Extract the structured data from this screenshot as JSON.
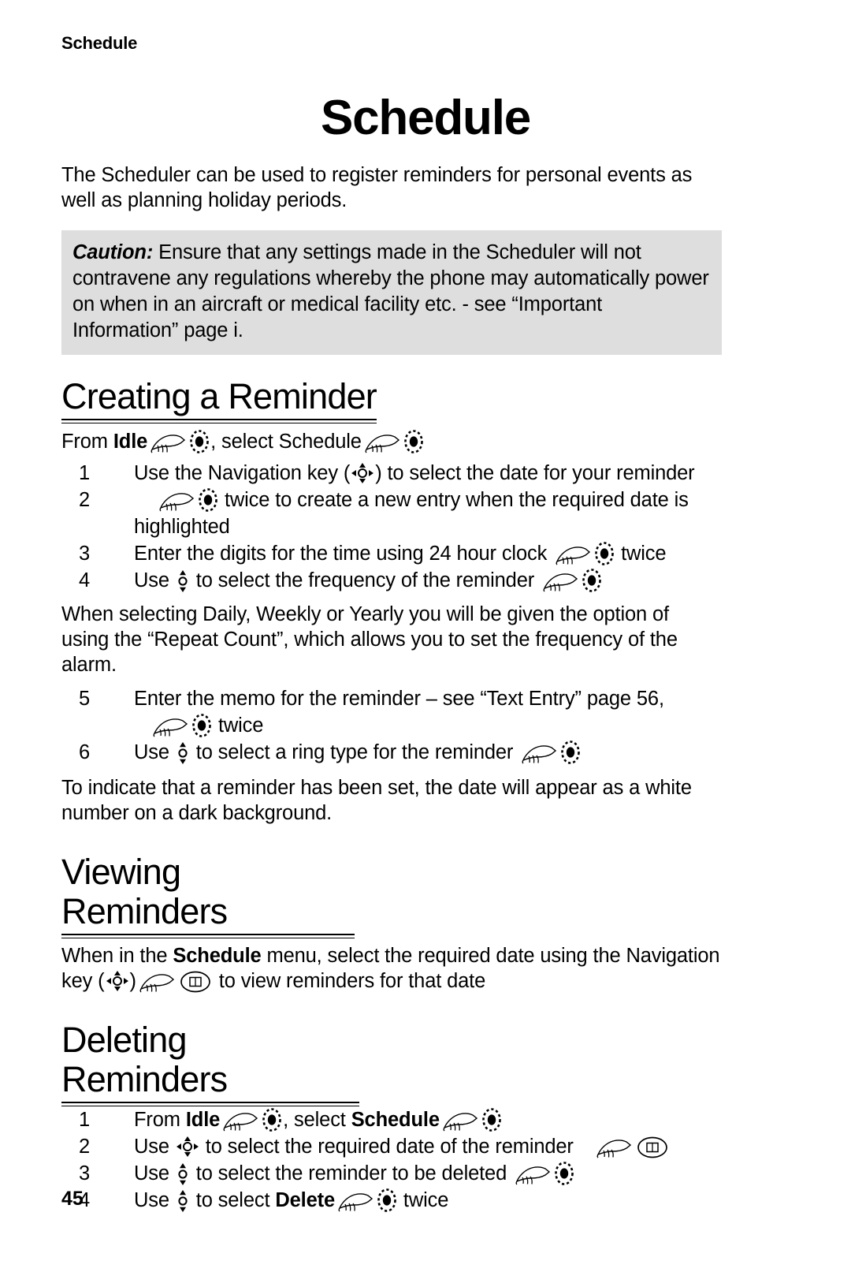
{
  "header": {
    "running_header": "Schedule",
    "title": "Schedule"
  },
  "intro": {
    "text": "The Scheduler can be used to register reminders for personal events as well as planning holiday periods."
  },
  "caution": {
    "label": "Caution:",
    "text": " Ensure that any settings made in the Scheduler will not contravene any regulations whereby the phone may automatically power on when in an aircraft or medical facility etc. - see “Important Information” page i.",
    "background_color": "#dedede"
  },
  "sections": {
    "creating": {
      "heading": "Creating a Reminder",
      "lead": {
        "from": "From ",
        "idle": "Idle",
        "comma_select": ", select Schedule"
      },
      "steps": [
        {
          "num": "1",
          "parts": [
            "Use the Navigation key (",
            ") to select the date for your reminder"
          ],
          "icons": [
            "nav-4way-icon"
          ]
        },
        {
          "num": "2",
          "parts": [
            "",
            "twice to create a new entry when the required date is highlighted"
          ],
          "icons": [
            "hand-pointer-icon",
            "select-key-icon"
          ]
        },
        {
          "num": "3",
          "parts": [
            "Enter the digits for the time using 24 hour clock ",
            "twice"
          ],
          "icons": [
            "hand-pointer-icon",
            "select-key-icon"
          ]
        },
        {
          "num": "4",
          "parts": [
            "Use ",
            " to select the frequency of the reminder "
          ],
          "icons": [
            "nav-updown-icon",
            "hand-pointer-icon",
            "select-key-icon"
          ]
        }
      ],
      "note": "When selecting Daily, Weekly or Yearly you will be given the option of using the “Repeat Count”, which allows you to set the frequency of the alarm.",
      "steps2": [
        {
          "num": "5",
          "parts": [
            "Enter the memo for the reminder – see “Text Entry” page 56,",
            "twice"
          ],
          "icons": [
            "hand-pointer-icon",
            "select-key-icon"
          ]
        },
        {
          "num": "6",
          "parts": [
            "Use ",
            " to select a ring type for the reminder "
          ],
          "icons": [
            "nav-updown-icon",
            "hand-pointer-icon",
            "select-key-icon"
          ]
        }
      ],
      "closing": "To indicate that a reminder has been set, the date will appear as a white number on a dark background."
    },
    "viewing": {
      "heading": "Viewing Reminders",
      "body_1": "When in the ",
      "body_schedule": "Schedule",
      "body_2": " menu, select the required date using the Navigation key (",
      "body_3": ")",
      "body_4": "to view reminders for that date"
    },
    "deleting": {
      "heading": "Deleting Reminders",
      "steps": [
        {
          "num": "1",
          "pre": "From ",
          "bold1": "Idle",
          "mid": ", select ",
          "bold2": "Schedule"
        },
        {
          "num": "2",
          "pre": "Use ",
          "post": " to select the required date of the reminder "
        },
        {
          "num": "3",
          "pre": "Use ",
          "post": " to select the reminder to be deleted "
        },
        {
          "num": "4",
          "pre": "Use ",
          "mid": " to select ",
          "bold": "Delete",
          "post": "twice"
        }
      ]
    }
  },
  "footer": {
    "page_number": "45"
  }
}
